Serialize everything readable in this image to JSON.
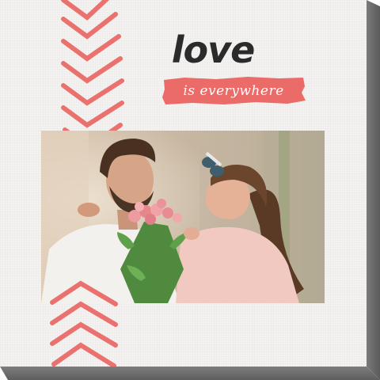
{
  "artwork": {
    "title": "love",
    "subtitle": "is everywhere",
    "accent_color": "#ea6b68",
    "text_color": "#2b2b2b",
    "photo": "couple-with-roses-photo"
  }
}
